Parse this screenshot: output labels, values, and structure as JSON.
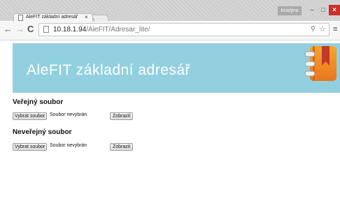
{
  "browser": {
    "tab_title": "AleFIT základní adresář",
    "tab_close": "×",
    "user_name": "Kristýna",
    "url_host": "10.18.1.94",
    "url_path": "/AleFIT/Adresar_lite/",
    "window_controls": {
      "minimize": "–",
      "maximize": "□",
      "close": "×"
    },
    "nav": {
      "back": "←",
      "forward": "→",
      "reload": "C"
    },
    "icons": {
      "zoom": "⚲",
      "star": "☆",
      "menu": "≡"
    }
  },
  "page": {
    "banner_title": "AleFIT základní adresář",
    "banner_color": "#93d0df",
    "sections": [
      {
        "heading": "Veřejný soubor",
        "choose_label": "Vybrat soubor",
        "status": "Soubor nevybrán",
        "show_label": "Zobrazit"
      },
      {
        "heading": "Neveřejný soubor",
        "choose_label": "Vybrat soubor",
        "status": "Soubor nevybrán",
        "show_label": "Zobrazit"
      }
    ]
  }
}
